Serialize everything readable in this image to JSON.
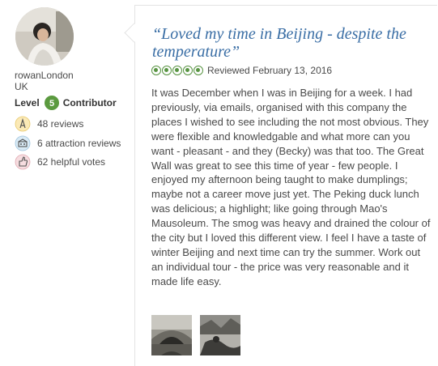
{
  "reviewer": {
    "username": "rowanLondon",
    "country": "UK",
    "level_label": "Level",
    "level_number": "5",
    "level_title": "Contributor",
    "stats": [
      {
        "icon": "pen-icon",
        "text": "48 reviews"
      },
      {
        "icon": "attraction-icon",
        "text": "6 attraction reviews"
      },
      {
        "icon": "thumbs-up-icon",
        "text": "62 helpful votes"
      }
    ]
  },
  "review": {
    "title": "“Loved my time in Beijing - despite the temperature”",
    "rating": 5,
    "rating_max": 5,
    "reviewed_date": "Reviewed February 13, 2016",
    "body": "It was December when I was in Beijing for a week. I had previously, via emails, organised with this company the places I wished to see including the not most obvious. They were flexible and knowledgable and what more can you want - pleasant - and they (Becky) was that too. The Great Wall was great to see this time of year - few people. I enjoyed my afternoon being taught to make dumplings; maybe not a career move just yet. The Peking duck lunch was delicious; a highlight; like going through Mao's Mausoleum. The smog was heavy and drained the colour of the city but I loved this different view. I feel I have a taste of winter Beijing and next time can try the summer. Work out an individual tour - the price was very reasonable and it made life easy."
  },
  "colors": {
    "title_blue": "#3a6ea5",
    "bubble_green": "#589442",
    "badge_green": "#5b9a3f"
  }
}
